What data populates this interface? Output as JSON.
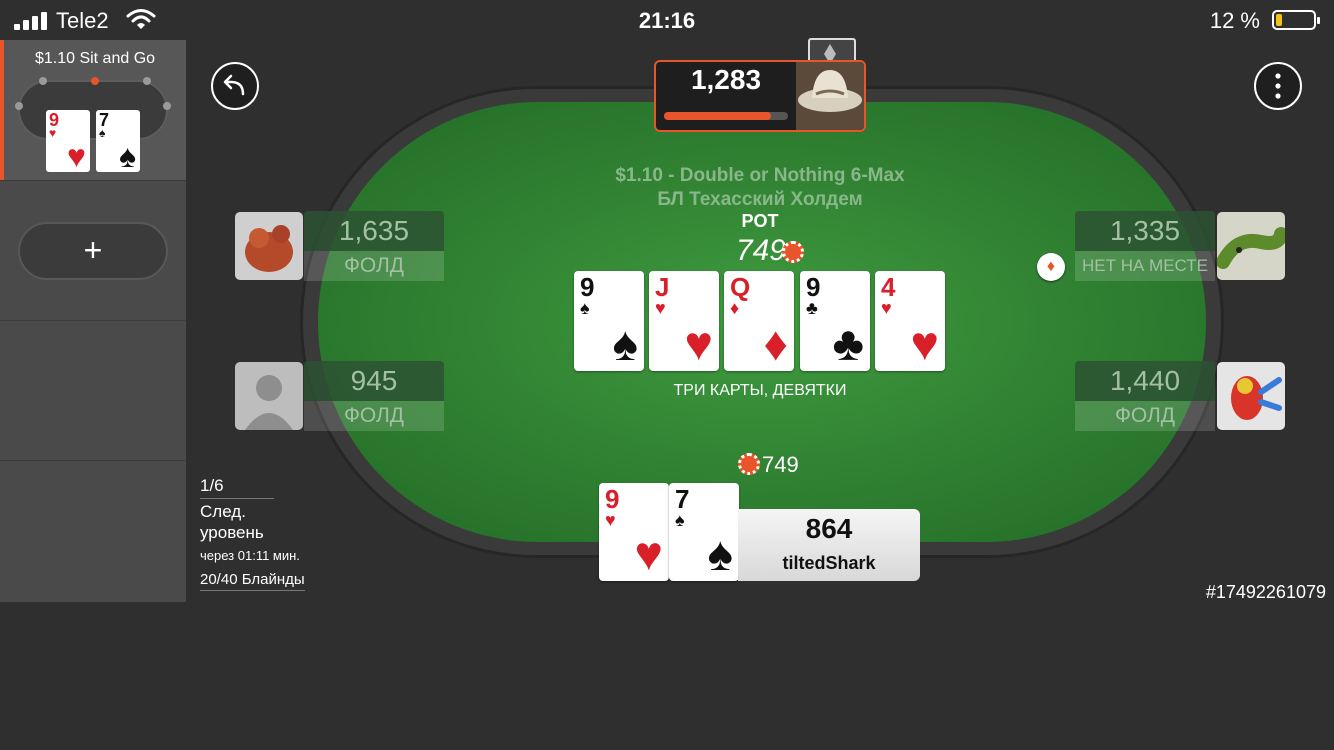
{
  "status_bar": {
    "carrier": "Tele2",
    "time": "21:16",
    "battery_percent": "12 %"
  },
  "lobby": {
    "sng_tab_label": "$1.10 Sit and Go",
    "mini_hand": [
      {
        "rank": "9",
        "suit": "♥"
      },
      {
        "rank": "7",
        "suit": "♠"
      }
    ],
    "add_table_label": "+"
  },
  "table": {
    "game_title": "$1.10 - Double or Nothing 6-Max",
    "game_subtitle": "БЛ Техасский Холдем",
    "pot_label": "POT",
    "pot_value": "749",
    "board": [
      {
        "rank": "9",
        "suit": "♠",
        "color": "black"
      },
      {
        "rank": "J",
        "suit": "♥",
        "color": "red"
      },
      {
        "rank": "Q",
        "suit": "♦",
        "color": "red"
      },
      {
        "rank": "9",
        "suit": "♣",
        "color": "black"
      },
      {
        "rank": "4",
        "suit": "♥",
        "color": "red"
      }
    ],
    "hand_description": "ТРИ КАРТЫ, ДЕВЯТКИ",
    "hero_bet": "749",
    "hand_id": "#17492261079"
  },
  "seats": {
    "top": {
      "stack": "1,283",
      "timer_fraction": 0.86
    },
    "left_upper": {
      "stack": "1,635",
      "status": "ФОЛД"
    },
    "left_lower": {
      "stack": "945",
      "status": "ФОЛД"
    },
    "right_upper": {
      "stack": "1,335",
      "status": "НЕТ НА МЕСТЕ"
    },
    "right_lower": {
      "stack": "1,440",
      "status": "ФОЛД"
    }
  },
  "hero": {
    "stack": "864",
    "name": "tiltedShark",
    "cards": [
      {
        "rank": "9",
        "suit": "♥",
        "color": "red"
      },
      {
        "rank": "7",
        "suit": "♠",
        "color": "black"
      }
    ]
  },
  "level": {
    "players": "1/6",
    "next_level_line1": "След.",
    "next_level_line2": "уровень",
    "time_remaining": "через 01:11 мин.",
    "blinds": "20/40 Блайнды"
  },
  "colors": {
    "accent": "#e8552a",
    "felt": "#2f7f31",
    "background": "#2f2f2f"
  },
  "icons": {
    "back": "back-arrow-icon",
    "menu": "more-vertical-icon",
    "dealer": "dealer-button-icon",
    "chip": "chip-icon"
  }
}
